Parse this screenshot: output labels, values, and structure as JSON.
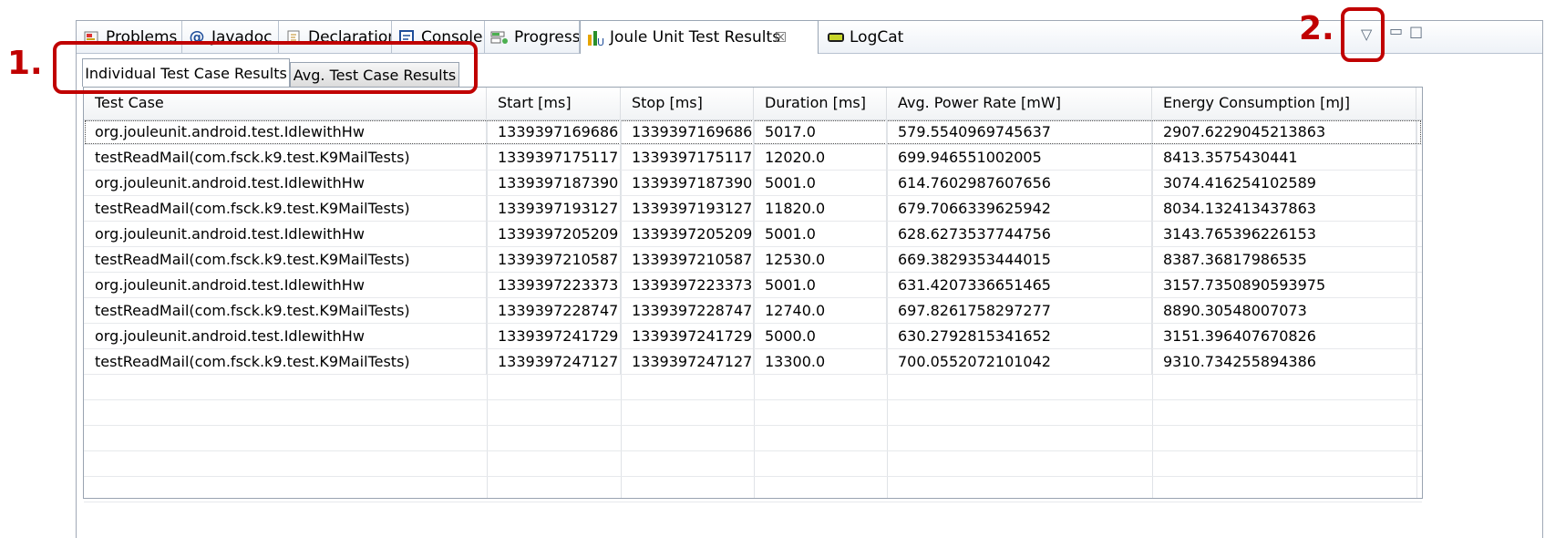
{
  "view_tabs": [
    {
      "label": "Problems",
      "icon": "problems-icon"
    },
    {
      "label": "Javadoc",
      "icon": "at-sign-icon"
    },
    {
      "label": "Declaration",
      "icon": "declaration-icon"
    },
    {
      "label": "Console",
      "icon": "console-icon"
    },
    {
      "label": "Progress",
      "icon": "progress-icon"
    },
    {
      "label": "Joule Unit Test Results",
      "icon": "joule-unit-icon",
      "active": true,
      "close": "☒"
    },
    {
      "label": "LogCat",
      "icon": "android-logcat-icon"
    }
  ],
  "view_menu": {
    "dropdown": "▽",
    "minimize": "▭",
    "maximize": "□"
  },
  "sub_tabs": [
    {
      "label": "Individual Test Case Results",
      "active": true
    },
    {
      "label": "Avg. Test Case Results",
      "active": false
    }
  ],
  "table": {
    "columns": [
      "Test Case",
      "Start [ms]",
      "Stop [ms]",
      "Duration [ms]",
      "Avg. Power Rate [mW]",
      "Energy Consumption [mJ]"
    ],
    "rows": [
      [
        "org.jouleunit.android.test.IdlewithHw",
        "1339397169686",
        "1339397169686",
        "5017.0",
        "579.5540969745637",
        "2907.6229045213863"
      ],
      [
        "testReadMail(com.fsck.k9.test.K9MailTests)",
        "1339397175117",
        "1339397175117",
        "12020.0",
        "699.946551002005",
        "8413.3575430441"
      ],
      [
        "org.jouleunit.android.test.IdlewithHw",
        "1339397187390",
        "1339397187390",
        "5001.0",
        "614.7602987607656",
        "3074.416254102589"
      ],
      [
        "testReadMail(com.fsck.k9.test.K9MailTests)",
        "1339397193127",
        "1339397193127",
        "11820.0",
        "679.7066339625942",
        "8034.132413437863"
      ],
      [
        "org.jouleunit.android.test.IdlewithHw",
        "1339397205209",
        "1339397205209",
        "5001.0",
        "628.6273537744756",
        "3143.765396226153"
      ],
      [
        "testReadMail(com.fsck.k9.test.K9MailTests)",
        "1339397210587",
        "1339397210587",
        "12530.0",
        "669.3829353444015",
        "8387.36817986535"
      ],
      [
        "org.jouleunit.android.test.IdlewithHw",
        "1339397223373",
        "1339397223373",
        "5001.0",
        "631.4207336651465",
        "3157.7350890593975"
      ],
      [
        "testReadMail(com.fsck.k9.test.K9MailTests)",
        "1339397228747",
        "1339397228747",
        "12740.0",
        "697.8261758297277",
        "8890.30548007073"
      ],
      [
        "org.jouleunit.android.test.IdlewithHw",
        "1339397241729",
        "1339397241729",
        "5000.0",
        "630.2792815341652",
        "3151.396407670826"
      ],
      [
        "testReadMail(com.fsck.k9.test.K9MailTests)",
        "1339397247127",
        "1339397247127",
        "13300.0",
        "700.0552072101042",
        "9310.734255894386"
      ]
    ]
  },
  "annotations": {
    "label_1": "1.",
    "label_2": "2."
  },
  "colors": {
    "annotation": "#c00000",
    "accent": "#1f4e9a"
  }
}
